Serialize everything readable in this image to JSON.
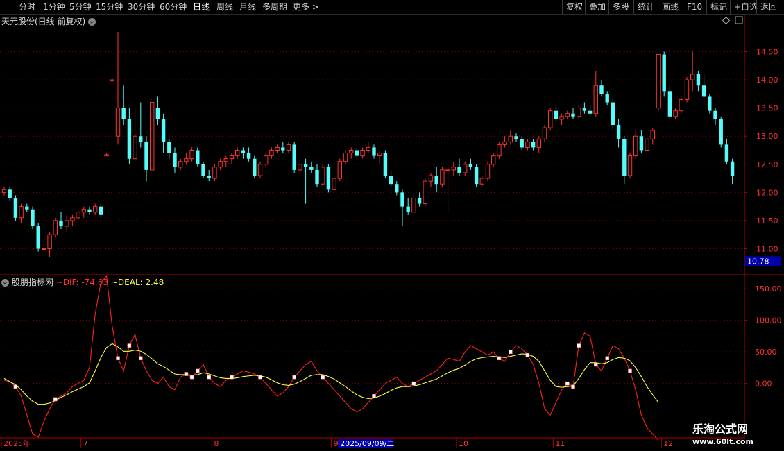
{
  "toolbar": {
    "periods": [
      "分时",
      "1分钟",
      "5分钟",
      "15分钟",
      "30分钟",
      "60分钟",
      "日线",
      "周线",
      "月线",
      "多周期",
      "更多"
    ],
    "active_period": "日线",
    "more_arrow": ">",
    "right_buttons": [
      "复权",
      "叠加",
      "多股",
      "统计",
      "画线",
      "F10",
      "标记",
      "+自选",
      "返回"
    ]
  },
  "main_title": "天元股份(日线 前复权)",
  "indicator": {
    "name": "股朋指标网",
    "dif_label": "~DIF: -74.63",
    "deal_label": "~DEAL: 2.48"
  },
  "colors": {
    "up": "#ff3232",
    "down": "#54fcfc",
    "dif": "#ff2020",
    "deal": "#ffff40",
    "grid": "#800000",
    "axis": "#b00000",
    "price_tag_bg": "#0000a8"
  },
  "watermark": {
    "line1": "乐淘公式网",
    "line2": "www.60lt.com"
  },
  "chart_data": [
    {
      "type": "candlestick",
      "title": "天元股份(日线 前复权)",
      "y_ticks": [
        11.0,
        11.5,
        12.0,
        12.5,
        13.0,
        13.5,
        14.0,
        14.5
      ],
      "ylim": [
        10.55,
        14.95
      ],
      "current_price_tag": "10.78",
      "x_ticks": [
        {
          "label": "2025年",
          "index": 0
        },
        {
          "label": "7",
          "index": 14
        },
        {
          "label": "8",
          "index": 37
        },
        {
          "label": "9",
          "index": 58
        },
        {
          "label": "10",
          "index": 80
        },
        {
          "label": "11",
          "index": 97
        },
        {
          "label": "12",
          "index": 116
        }
      ],
      "cursor_date": {
        "label": "2025/09/09/二",
        "index": 66
      },
      "ohlc": [
        [
          12.0,
          12.1,
          11.95,
          12.05
        ],
        [
          12.05,
          12.1,
          11.85,
          11.9
        ],
        [
          11.9,
          11.95,
          11.5,
          11.55
        ],
        [
          11.55,
          11.8,
          11.45,
          11.75
        ],
        [
          11.75,
          11.8,
          11.65,
          11.7
        ],
        [
          11.7,
          11.75,
          11.35,
          11.4
        ],
        [
          11.4,
          11.45,
          10.95,
          11.0
        ],
        [
          11.0,
          11.05,
          10.95,
          11.0
        ],
        [
          11.0,
          11.3,
          10.85,
          11.25
        ],
        [
          11.25,
          11.55,
          11.2,
          11.5
        ],
        [
          11.5,
          11.65,
          11.35,
          11.4
        ],
        [
          11.4,
          11.6,
          11.3,
          11.5
        ],
        [
          11.5,
          11.6,
          11.4,
          11.55
        ],
        [
          11.55,
          11.7,
          11.45,
          11.65
        ],
        [
          11.65,
          11.75,
          11.55,
          11.7
        ],
        [
          11.7,
          11.75,
          11.6,
          11.65
        ],
        [
          11.65,
          11.8,
          11.6,
          11.75
        ],
        [
          11.75,
          11.8,
          11.55,
          11.6
        ],
        [
          12.65,
          12.7,
          12.65,
          12.67
        ],
        [
          13.98,
          14.02,
          13.98,
          14.0
        ],
        [
          13.0,
          14.85,
          12.85,
          13.5
        ],
        [
          13.5,
          13.9,
          13.2,
          13.3
        ],
        [
          13.3,
          13.5,
          12.5,
          12.6
        ],
        [
          12.6,
          13.5,
          12.55,
          13.0
        ],
        [
          13.0,
          13.6,
          12.8,
          12.9
        ],
        [
          12.9,
          13.0,
          12.2,
          12.4
        ],
        [
          12.4,
          13.6,
          12.4,
          13.6
        ],
        [
          13.5,
          13.7,
          13.2,
          13.3
        ],
        [
          13.3,
          13.4,
          12.7,
          12.9
        ],
        [
          12.9,
          12.95,
          12.6,
          12.7
        ],
        [
          12.7,
          12.8,
          12.35,
          12.45
        ],
        [
          12.45,
          12.6,
          12.4,
          12.55
        ],
        [
          12.55,
          12.7,
          12.5,
          12.6
        ],
        [
          12.6,
          12.8,
          12.55,
          12.75
        ],
        [
          12.75,
          12.8,
          12.45,
          12.5
        ],
        [
          12.5,
          12.55,
          12.25,
          12.3
        ],
        [
          12.3,
          12.4,
          12.2,
          12.25
        ],
        [
          12.25,
          12.5,
          12.2,
          12.45
        ],
        [
          12.45,
          12.6,
          12.4,
          12.55
        ],
        [
          12.55,
          12.65,
          12.45,
          12.6
        ],
        [
          12.6,
          12.7,
          12.5,
          12.65
        ],
        [
          12.65,
          12.8,
          12.6,
          12.75
        ],
        [
          12.75,
          12.8,
          12.6,
          12.7
        ],
        [
          12.7,
          12.8,
          12.55,
          12.6
        ],
        [
          12.6,
          12.65,
          12.25,
          12.3
        ],
        [
          12.3,
          12.55,
          12.25,
          12.5
        ],
        [
          12.5,
          12.7,
          12.45,
          12.65
        ],
        [
          12.65,
          12.8,
          12.6,
          12.75
        ],
        [
          12.75,
          12.85,
          12.7,
          12.8
        ],
        [
          12.8,
          12.9,
          12.7,
          12.75
        ],
        [
          12.75,
          12.9,
          12.7,
          12.85
        ],
        [
          12.85,
          12.9,
          12.35,
          12.4
        ],
        [
          12.4,
          12.6,
          12.3,
          12.5
        ],
        [
          12.5,
          12.6,
          11.8,
          12.45
        ],
        [
          12.45,
          12.55,
          12.35,
          12.4
        ],
        [
          12.4,
          12.5,
          12.1,
          12.15
        ],
        [
          12.15,
          12.5,
          12.1,
          12.45
        ],
        [
          12.45,
          12.5,
          12.0,
          12.05
        ],
        [
          12.05,
          12.3,
          12.0,
          12.25
        ],
        [
          12.25,
          12.6,
          12.2,
          12.55
        ],
        [
          12.55,
          12.75,
          12.5,
          12.7
        ],
        [
          12.7,
          12.8,
          12.6,
          12.75
        ],
        [
          12.75,
          12.8,
          12.6,
          12.65
        ],
        [
          12.65,
          12.8,
          12.6,
          12.75
        ],
        [
          12.75,
          12.9,
          12.7,
          12.8
        ],
        [
          12.8,
          12.85,
          12.6,
          12.65
        ],
        [
          12.65,
          12.75,
          12.5,
          12.7
        ],
        [
          12.7,
          12.75,
          12.25,
          12.3
        ],
        [
          12.3,
          12.4,
          12.1,
          12.15
        ],
        [
          12.15,
          12.2,
          11.95,
          12.0
        ],
        [
          12.0,
          12.05,
          11.4,
          11.75
        ],
        [
          11.75,
          11.9,
          11.6,
          11.65
        ],
        [
          11.65,
          11.95,
          11.6,
          11.9
        ],
        [
          11.9,
          12.0,
          11.75,
          11.8
        ],
        [
          11.8,
          12.25,
          11.75,
          12.2
        ],
        [
          12.2,
          12.35,
          12.1,
          12.3
        ],
        [
          12.3,
          12.45,
          12.0,
          12.15
        ],
        [
          12.15,
          12.45,
          12.1,
          12.4
        ],
        [
          12.4,
          12.45,
          11.65,
          12.4
        ],
        [
          12.4,
          12.55,
          12.3,
          12.45
        ],
        [
          12.45,
          12.6,
          12.3,
          12.35
        ],
        [
          12.35,
          12.55,
          12.3,
          12.5
        ],
        [
          12.5,
          12.6,
          12.4,
          12.45
        ],
        [
          12.45,
          12.5,
          12.1,
          12.15
        ],
        [
          12.15,
          12.3,
          12.1,
          12.25
        ],
        [
          12.25,
          12.55,
          12.2,
          12.5
        ],
        [
          12.5,
          12.7,
          12.45,
          12.65
        ],
        [
          12.65,
          12.9,
          12.6,
          12.85
        ],
        [
          12.85,
          13.0,
          12.8,
          12.9
        ],
        [
          12.9,
          13.1,
          12.85,
          13.0
        ],
        [
          13.0,
          13.05,
          12.9,
          12.95
        ],
        [
          12.95,
          13.0,
          12.75,
          12.8
        ],
        [
          12.8,
          12.95,
          12.75,
          12.9
        ],
        [
          12.9,
          12.95,
          12.75,
          12.8
        ],
        [
          12.8,
          13.0,
          12.7,
          12.95
        ],
        [
          12.95,
          13.2,
          12.9,
          13.15
        ],
        [
          13.15,
          13.5,
          13.1,
          13.45
        ],
        [
          13.45,
          13.55,
          13.25,
          13.3
        ],
        [
          13.3,
          13.4,
          13.2,
          13.35
        ],
        [
          13.35,
          13.45,
          13.3,
          13.4
        ],
        [
          13.4,
          13.5,
          13.3,
          13.35
        ],
        [
          13.35,
          13.55,
          13.3,
          13.5
        ],
        [
          13.5,
          13.6,
          13.4,
          13.45
        ],
        [
          13.45,
          13.55,
          13.35,
          13.4
        ],
        [
          13.4,
          14.15,
          13.35,
          13.9
        ],
        [
          13.9,
          14.0,
          13.7,
          13.75
        ],
        [
          13.75,
          13.8,
          13.55,
          13.6
        ],
        [
          13.6,
          13.7,
          13.1,
          13.2
        ],
        [
          13.2,
          13.3,
          12.8,
          12.95
        ],
        [
          12.95,
          13.0,
          12.15,
          12.3
        ],
        [
          12.3,
          12.7,
          12.25,
          12.65
        ],
        [
          12.65,
          13.1,
          12.6,
          13.0
        ],
        [
          13.0,
          13.1,
          12.7,
          12.75
        ],
        [
          12.75,
          13.0,
          12.7,
          12.95
        ],
        [
          12.95,
          13.15,
          12.85,
          13.1
        ],
        [
          13.5,
          14.45,
          13.45,
          14.45
        ],
        [
          14.45,
          14.5,
          13.7,
          13.8
        ],
        [
          13.8,
          13.9,
          13.3,
          13.35
        ],
        [
          13.35,
          13.5,
          13.3,
          13.45
        ],
        [
          13.45,
          13.7,
          13.4,
          13.65
        ],
        [
          13.65,
          14.05,
          13.6,
          14.0
        ],
        [
          14.0,
          14.5,
          13.8,
          14.1
        ],
        [
          14.1,
          14.15,
          13.8,
          13.9
        ],
        [
          13.9,
          14.1,
          13.65,
          13.7
        ],
        [
          13.7,
          13.75,
          13.4,
          13.45
        ],
        [
          13.45,
          13.5,
          13.2,
          13.3
        ],
        [
          13.3,
          13.35,
          12.8,
          12.85
        ],
        [
          12.85,
          12.95,
          12.5,
          12.55
        ],
        [
          12.55,
          12.6,
          12.15,
          12.3
        ]
      ]
    },
    {
      "type": "line",
      "title": "股朋指标网",
      "y_ticks": [
        0.0,
        50.0,
        100.0,
        150.0
      ],
      "ylim": [
        -85,
        170
      ],
      "series": [
        {
          "name": "DIF",
          "values": [
            5,
            3,
            -5,
            -20,
            -50,
            -80,
            -85,
            -60,
            -40,
            -25,
            -20,
            -15,
            -5,
            0,
            5,
            25,
            110,
            160,
            170,
            90,
            40,
            20,
            60,
            78,
            40,
            20,
            5,
            0,
            10,
            -5,
            -10,
            10,
            15,
            10,
            20,
            30,
            10,
            0,
            -5,
            5,
            10,
            15,
            20,
            18,
            15,
            10,
            0,
            -10,
            -20,
            -15,
            -5,
            10,
            20,
            30,
            35,
            20,
            10,
            0,
            -10,
            -20,
            -30,
            -40,
            -45,
            -40,
            -30,
            -20,
            -10,
            0,
            5,
            10,
            0,
            -5,
            0,
            5,
            10,
            15,
            20,
            30,
            40,
            38,
            35,
            50,
            60,
            55,
            50,
            45,
            50,
            40,
            35,
            50,
            60,
            55,
            45,
            30,
            0,
            -40,
            -50,
            -30,
            -10,
            0,
            -5,
            60,
            80,
            75,
            30,
            20,
            40,
            60,
            55,
            40,
            20,
            -10,
            -50,
            -70,
            -80,
            -90
          ]
        },
        {
          "name": "DEAL",
          "values": [
            8,
            3,
            -2,
            -10,
            -20,
            -28,
            -33,
            -33,
            -31,
            -27,
            -22,
            -18,
            -13,
            -9,
            -5,
            1,
            20,
            41,
            57,
            63,
            58,
            51,
            51,
            53,
            51,
            46,
            39,
            31,
            27,
            21,
            15,
            14,
            14,
            13,
            14,
            17,
            15,
            12,
            9,
            8,
            8,
            9,
            11,
            12,
            13,
            12,
            10,
            6,
            1,
            -2,
            -3,
            -1,
            3,
            8,
            13,
            14,
            14,
            11,
            7,
            1,
            -5,
            -12,
            -18,
            -22,
            -24,
            -23,
            -20,
            -16,
            -11,
            -7,
            -5,
            -5,
            -4,
            -2,
            1,
            4,
            7,
            12,
            17,
            21,
            24,
            29,
            35,
            39,
            41,
            42,
            43,
            42,
            41,
            43,
            45,
            47,
            46,
            43,
            35,
            20,
            5,
            -5,
            -6,
            -5,
            -4,
            8,
            22,
            33,
            33,
            31,
            33,
            38,
            41,
            40,
            36,
            25,
            11,
            -5,
            -18,
            -30
          ]
        }
      ]
    }
  ]
}
